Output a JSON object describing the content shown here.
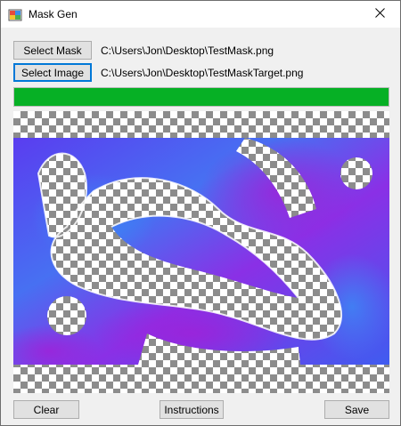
{
  "window": {
    "title": "Mask Gen",
    "app_icon": "windows-forms-app-icon",
    "close_icon": "close-icon"
  },
  "toolbar": {
    "select_mask_label": "Select Mask",
    "select_mask_path": "C:\\Users\\Jon\\Desktop\\TestMask.png",
    "select_image_label": "Select Image",
    "select_image_path": "C:\\Users\\Jon\\Desktop\\TestMaskTarget.png"
  },
  "progress": {
    "value": 1.0,
    "color": "#06b025"
  },
  "preview": {
    "description_colors": [
      "#6a3cf0",
      "#3f6cf5",
      "#9a25e0"
    ]
  },
  "footer": {
    "clear_label": "Clear",
    "instructions_label": "Instructions",
    "save_label": "Save"
  }
}
